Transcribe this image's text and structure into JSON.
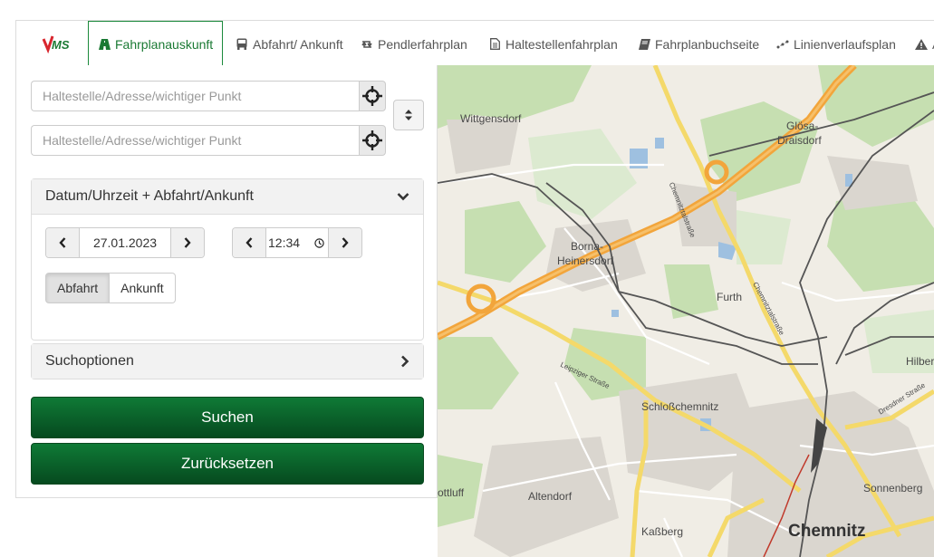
{
  "nav": {
    "logo_text": "VMS",
    "tabs": [
      {
        "label": "Fahrplanauskunft",
        "icon": "road-icon",
        "active": true
      },
      {
        "label": "Abfahrt/ Ankunft",
        "icon": "bus-icon"
      },
      {
        "label": "Pendlerfahrplan",
        "icon": "retweet-icon"
      },
      {
        "label": "Haltestellenfahrplan",
        "icon": "document-icon"
      },
      {
        "label": "Fahrplanbuchseite",
        "icon": "book-icon"
      },
      {
        "label": "Linienverlaufsplan",
        "icon": "route-icon"
      },
      {
        "label": "A",
        "icon": "warning-icon"
      }
    ]
  },
  "search": {
    "from_placeholder": "Haltestelle/Adresse/wichtiger Punkt",
    "to_placeholder": "Haltestelle/Adresse/wichtiger Punkt"
  },
  "datetime": {
    "title": "Datum/Uhrzeit + Abfahrt/Ankunft",
    "date": "27.01.2023",
    "time": "12:34",
    "modes": [
      "Abfahrt",
      "Ankunft"
    ],
    "selected_mode": "Abfahrt"
  },
  "options": {
    "title": "Suchoptionen"
  },
  "buttons": {
    "search": "Suchen",
    "reset": "Zurücksetzen"
  },
  "map": {
    "places": [
      "Wittgensdorf",
      "Glösa-",
      "Draisdorf",
      "Borna-",
      "Heinersdorf",
      "Furth",
      "Schloßchemnitz",
      "Hilbersd",
      "Altendorf",
      "Sonnenberg",
      "Kaßberg",
      "Chemnitz",
      "ottluff"
    ],
    "streets": [
      "Chemnitztalstraße",
      "Leipziger Straße",
      "Dresdner Straße"
    ]
  },
  "colors": {
    "brand_green": "#0f7a36",
    "active_tab": "#1b8a3c"
  }
}
